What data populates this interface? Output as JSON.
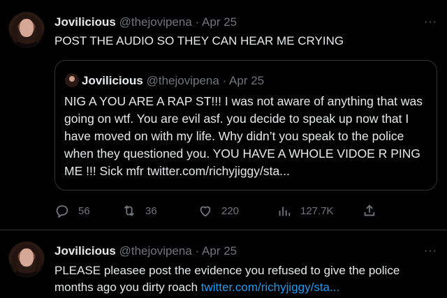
{
  "tweet1": {
    "name": "Jovilicious",
    "handle": "@thejovipena",
    "separator": "·",
    "date": "Apr 25",
    "more": "···",
    "text": "POST THE AUDIO SO THEY CAN HEAR ME CRYING",
    "quote": {
      "name": "Jovilicious",
      "handle": "@thejovipena",
      "separator": "·",
      "date": "Apr 25",
      "text": "NIG   A YOU ARE A RAP ST!!! I was not aware of anything that was going on wtf. You are evil asf. you decide to speak up now that I have moved on with my life. Why didn’t you speak to the police when they questioned you. YOU HAVE A WHOLE VIDOE R   PING ME !!! Sick mfr twitter.com/richyjiggy/sta..."
    },
    "actions": {
      "replies": "56",
      "retweets": "36",
      "likes": "220",
      "views": "127.7K"
    }
  },
  "tweet2": {
    "name": "Jovilicious",
    "handle": "@thejovipena",
    "separator": "·",
    "date": "Apr 25",
    "more": "···",
    "text": "PLEASE pleasee post the evidence you refused to give the police months ago you dirty roach ",
    "link": "twitter.com/richyjiggy/sta..."
  },
  "colors": {
    "background": "#000000",
    "text": "#e7e9ea",
    "muted": "#71767b",
    "border": "#2f3336",
    "link": "#1d9bf0"
  }
}
